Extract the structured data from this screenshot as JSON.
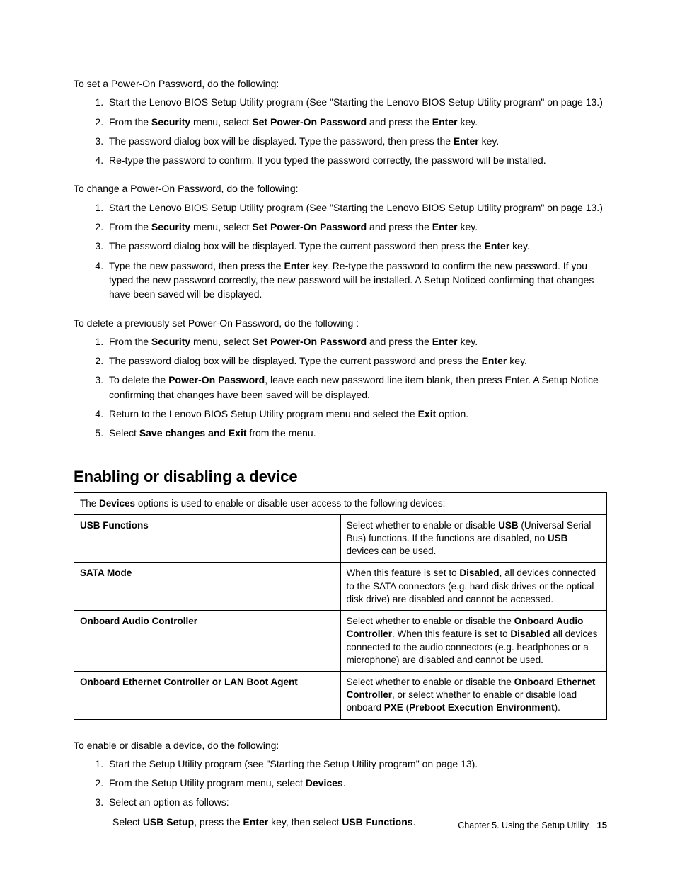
{
  "set": {
    "intro": "To set a Power-On Password, do the following:",
    "steps": [
      "Start the Lenovo BIOS Setup Utility program (See \"Starting the Lenovo BIOS Setup Utility program\" on page 13.)",
      "From the <b>Security</b> menu, select <b>Set Power-On Password</b> and press the <b>Enter</b> key.",
      "The password dialog box will be displayed. Type the password, then press the <b>Enter</b> key.",
      "Re-type the password to confirm. If you typed the password correctly, the password will be installed."
    ]
  },
  "change": {
    "intro": "To change a Power-On Password, do the following:",
    "steps": [
      "Start the Lenovo BIOS Setup Utility program (See \"Starting the Lenovo BIOS Setup Utility program\" on page 13.)",
      "From the <b>Security</b> menu, select <b>Set Power-On Password</b> and press the <b>Enter</b> key.",
      "The password dialog box will be displayed. Type the current password then press the <b>Enter</b> key.",
      "Type the new password, then press the <b>Enter</b> key. Re-type the password to confirm the new password. If you typed the new password correctly, the new password will be installed. A Setup Noticed confirming that changes have been saved will be displayed."
    ]
  },
  "delete": {
    "intro": "To delete a previously set Power-On Password, do the following :",
    "steps": [
      "From the <b>Security</b> menu, select <b>Set Power-On Password</b> and press the <b>Enter</b> key.",
      "The password dialog box will be displayed. Type the current password and press the <b>Enter</b> key.",
      "To delete the <b>Power-On Password</b>, leave each new password line item blank, then press Enter. A Setup Notice confirming that changes have been saved will be displayed.",
      "Return to the Lenovo BIOS Setup Utility program menu and select the <b>Exit</b> option.",
      "Select <b>Save changes and Exit</b> from the menu."
    ]
  },
  "heading": "Enabling or disabling a device",
  "tableIntro": "The <b>Devices</b> options is used to enable or disable user access to the following devices:",
  "rows": [
    {
      "label": "USB Functions",
      "desc": "Select whether to enable or disable <b>USB</b> (Universal Serial Bus) functions. If the functions are disabled, no <b>USB</b> devices can be used."
    },
    {
      "label": "SATA Mode",
      "desc": "When this feature is set to <b>Disabled</b>, all devices connected to the SATA connectors (e.g. hard disk drives or the optical disk drive) are disabled and cannot be accessed."
    },
    {
      "label": "Onboard Audio Controller",
      "desc": "Select whether to enable or disable the <b>Onboard Audio Controller</b>. When this feature is set to <b>Disabled</b> all devices connected to the audio connectors (e.g. headphones or a microphone) are disabled and cannot be used."
    },
    {
      "label": "Onboard Ethernet Controller or LAN Boot Agent",
      "desc": "Select whether to enable or disable the <b>Onboard Ethernet Controller</b>, or select whether to enable or disable load onboard <b>PXE</b> (<b>Preboot Execution Environment</b>)."
    }
  ],
  "enable": {
    "intro": "To enable or disable a device, do the following:",
    "steps": [
      "Start the Setup Utility program (see \"Starting the Setup Utility program\" on page 13).",
      "From the Setup Utility program menu, select <b>Devices</b>.",
      "Select an option as follows:"
    ],
    "sub": "Select <b>USB Setup</b>, press the <b>Enter</b> key, then select <b>USB Functions</b>."
  },
  "footer": {
    "chapter": "Chapter 5. Using the Setup Utility",
    "page": "15"
  }
}
